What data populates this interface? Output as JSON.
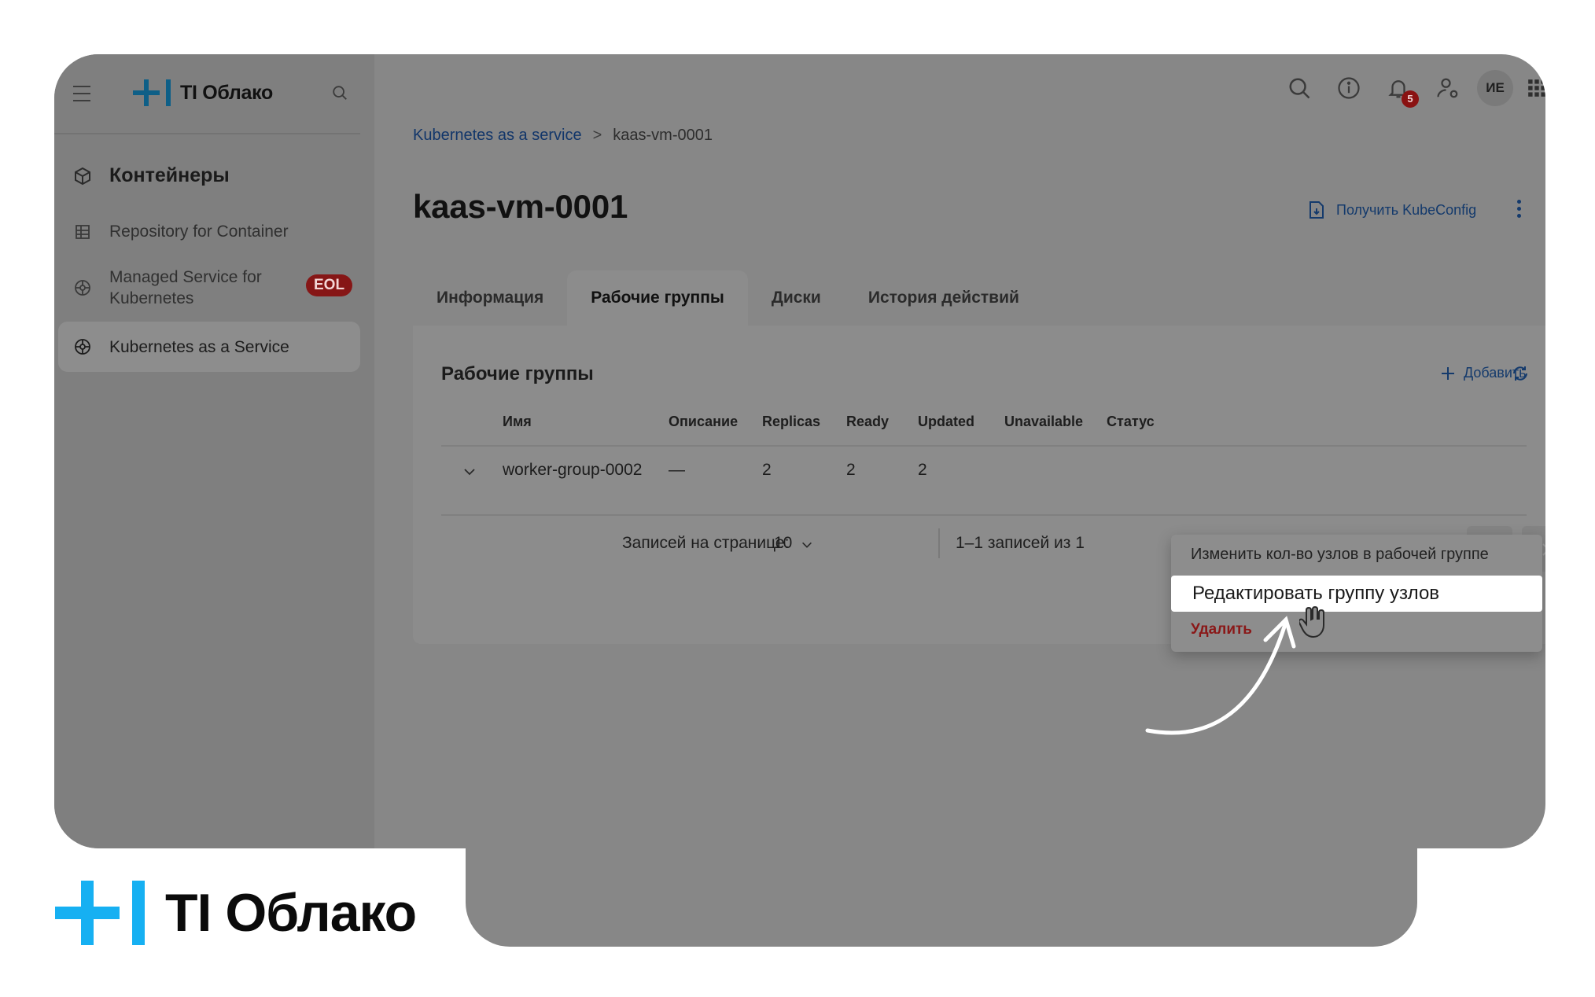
{
  "brand": {
    "name": "TI Облако",
    "accent": "#16b0f2"
  },
  "sidebar": {
    "section": "Контейнеры",
    "items": [
      {
        "label": "Repository for Container"
      },
      {
        "label": "Managed Service for Kubernetes",
        "badge": "EOL"
      },
      {
        "label": "Kubernetes as a Service",
        "active": true
      }
    ]
  },
  "topbar": {
    "notifications_count": "5",
    "avatar_initials": "ИЕ"
  },
  "breadcrumb": {
    "root": "Kubernetes as a service",
    "separator": ">",
    "current": "kaas-vm-0001"
  },
  "page": {
    "title": "kaas-vm-0001",
    "kubeconfig_label": "Получить KubeConfig"
  },
  "tabs": [
    {
      "label": "Информация"
    },
    {
      "label": "Рабочие группы",
      "active": true
    },
    {
      "label": "Диски"
    },
    {
      "label": "История действий"
    }
  ],
  "panel": {
    "title": "Рабочие группы",
    "add_label": "Добавить",
    "columns": [
      "Имя",
      "Описание",
      "Replicas",
      "Ready",
      "Updated",
      "Unavailable",
      "Статус"
    ],
    "rows": [
      {
        "name": "worker-group-0002",
        "description": "—",
        "replicas": "2",
        "ready": "2",
        "updated": "2"
      }
    ],
    "pager": {
      "per_page_label": "Записей на странице:",
      "per_page_value": "10",
      "range": "1–1 записей из 1"
    }
  },
  "menu": {
    "items": [
      {
        "label": "Изменить кол-во узлов в рабочей группе"
      },
      {
        "label": "Редактировать группу узлов",
        "highlighted": true
      },
      {
        "label": "Удалить",
        "danger": true
      }
    ]
  },
  "footer_brand": "TI Облако"
}
